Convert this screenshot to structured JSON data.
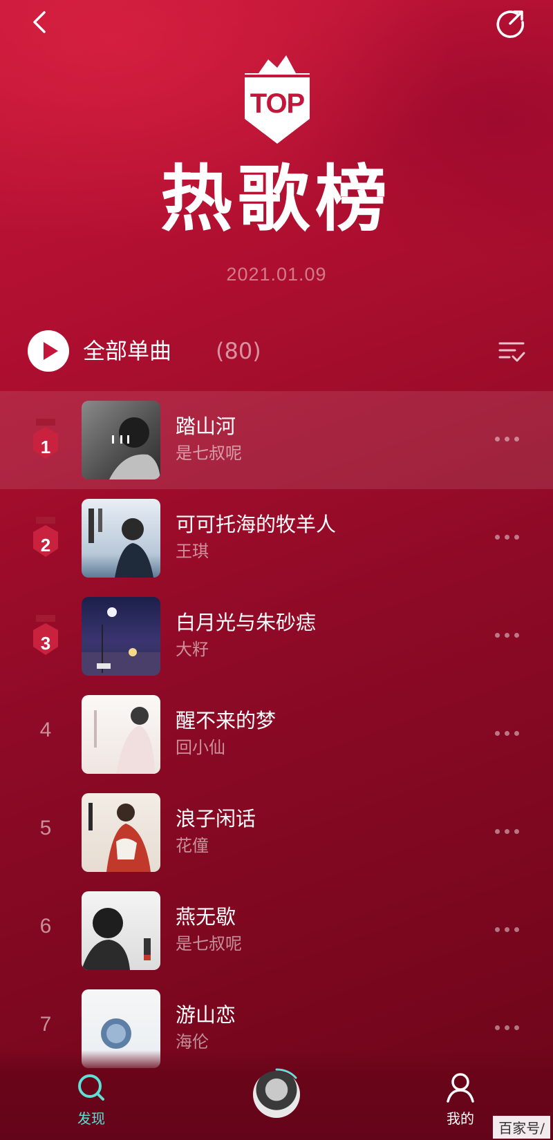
{
  "header": {
    "badge_text": "TOP",
    "title": "热歌榜",
    "date": "2021.01.09"
  },
  "play_all": {
    "label": "全部单曲",
    "count": "(80)"
  },
  "songs": [
    {
      "rank": "1",
      "title": "踏山河",
      "artist": "是七叔呢",
      "active": true
    },
    {
      "rank": "2",
      "title": "可可托海的牧羊人",
      "artist": "王琪"
    },
    {
      "rank": "3",
      "title": "白月光与朱砂痣",
      "artist": "大籽"
    },
    {
      "rank": "4",
      "title": "醒不来的梦",
      "artist": "回小仙"
    },
    {
      "rank": "5",
      "title": "浪子闲话",
      "artist": "花僮"
    },
    {
      "rank": "6",
      "title": "燕无歇",
      "artist": "是七叔呢"
    },
    {
      "rank": "7",
      "title": "游山恋",
      "artist": "海伦"
    }
  ],
  "tabbar": {
    "discover_label": "发现",
    "mine_label": "我的"
  },
  "watermark": "百家号/",
  "colors": {
    "accent": "#c4163a",
    "tab_active": "#5fe0d6",
    "medal": "#c8223f"
  },
  "icons": [
    "back-arrow-icon",
    "share-icon",
    "play-icon",
    "multiselect-icon",
    "more-dots-icon",
    "search-discover-icon",
    "user-icon"
  ]
}
